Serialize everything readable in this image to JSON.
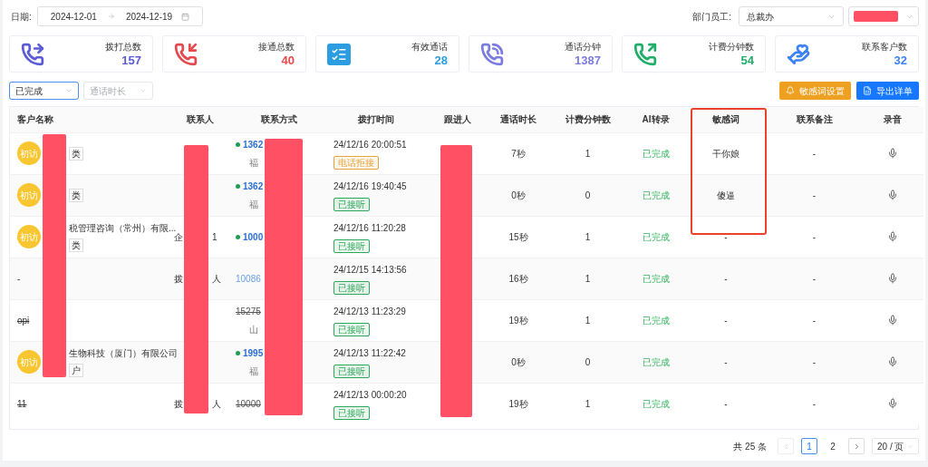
{
  "filters": {
    "date_label": "日期:",
    "date_start": "2024-12-01",
    "date_end": "2024-12-19",
    "dept_label": "部门员工:",
    "dept_value": "总裁办"
  },
  "stats": [
    {
      "label": "拨打总数",
      "value": "157",
      "color": "#5b5bd6"
    },
    {
      "label": "接通总数",
      "value": "40",
      "color": "#e5484d"
    },
    {
      "label": "有效通话",
      "value": "28",
      "color": "#2b9de0"
    },
    {
      "label": "通话分钟",
      "value": "1387",
      "color": "#7b7be0"
    },
    {
      "label": "计费分钟数",
      "value": "54",
      "color": "#1fae68"
    },
    {
      "label": "联系客户数",
      "value": "32",
      "color": "#3b82f6"
    }
  ],
  "status_select": {
    "value": "已完成"
  },
  "duration_select": {
    "placeholder": "通话时长"
  },
  "buttons": [
    {
      "label": "敏感词设置",
      "kind": "warning"
    },
    {
      "label": "导出详单",
      "kind": "primary"
    }
  ],
  "table": {
    "columns": [
      "客户名称",
      "联系人",
      "联系方式",
      "拨打时间",
      "跟进人",
      "通话时长",
      "计费分钟数",
      "AI转录",
      "敏感词",
      "联系备注",
      "录音"
    ],
    "rows": [
      {
        "avatar": "初访",
        "name": "",
        "tag": "类",
        "struck": false,
        "contact": [],
        "number": "1362",
        "dot": true,
        "region": "福",
        "time": "24/12/16 20:00:51",
        "status": {
          "text": "电话拒接",
          "color": "#e6a23c"
        },
        "duration": "7秒",
        "billing": "1",
        "ai": "已完成",
        "sensitive": "干你娘",
        "note": "-"
      },
      {
        "avatar": "初访",
        "name": "",
        "tag": "类",
        "struck": false,
        "contact": [],
        "number": "1362",
        "dot": true,
        "region": "福",
        "time": "24/12/16 19:40:45",
        "status": {
          "text": "已接听",
          "color": "#2da85a"
        },
        "duration": "0秒",
        "billing": "0",
        "ai": "已完成",
        "sensitive": "傻逼",
        "note": "-"
      },
      {
        "avatar": "初访",
        "name": "税管理咨询（常州）有限...",
        "tag": "类",
        "struck": false,
        "contact": [
          "企",
          "1"
        ],
        "number": "1000",
        "dot": true,
        "region": "",
        "time": "24/12/16 11:20:28",
        "status": {
          "text": "已接听",
          "color": "#2da85a"
        },
        "duration": "15秒",
        "billing": "1",
        "ai": "已完成",
        "sensitive": "-",
        "note": "-"
      },
      {
        "avatar": "",
        "name": "-",
        "tag": "",
        "struck": false,
        "contact": [
          "拨",
          "人"
        ],
        "number": "10086",
        "dot": false,
        "region": "",
        "time": "24/12/15 14:13:56",
        "status": {
          "text": "已接听",
          "color": "#2da85a"
        },
        "duration": "16秒",
        "billing": "1",
        "ai": "已完成",
        "sensitive": "-",
        "note": "-"
      },
      {
        "avatar": "",
        "name": "opi",
        "tag": "",
        "struck": true,
        "contact": [],
        "number": "15275",
        "dot": false,
        "region": "山",
        "time": "24/12/13 11:23:29",
        "status": {
          "text": "已接听",
          "color": "#2da85a"
        },
        "duration": "19秒",
        "billing": "1",
        "ai": "已完成",
        "sensitive": "-",
        "note": "-"
      },
      {
        "avatar": "初访",
        "name": "生物科技（厦门）有限公司",
        "tag": "户",
        "struck": false,
        "contact": [],
        "number": "1995",
        "dot": true,
        "region": "福",
        "time": "24/12/13 11:22:42",
        "status": {
          "text": "已接听",
          "color": "#2da85a"
        },
        "duration": "0秒",
        "billing": "0",
        "ai": "已完成",
        "sensitive": "-",
        "note": "-"
      },
      {
        "avatar": "",
        "name": "11",
        "tag": "",
        "struck": true,
        "contact": [
          "拨",
          "人"
        ],
        "number": "10000",
        "dot": false,
        "region": "",
        "time": "24/12/13 00:00:20",
        "status": {
          "text": "已接听",
          "color": "#2da85a"
        },
        "duration": "19秒",
        "billing": "1",
        "ai": "已完成",
        "sensitive": "-",
        "note": "-"
      }
    ]
  },
  "pagination": {
    "total": "共 25 条",
    "pages": [
      {
        "label": "1",
        "selected": true
      },
      {
        "label": "2",
        "selected": false
      }
    ],
    "prev_disabled": true,
    "next_disabled": false,
    "page_size": "20 / 页"
  }
}
